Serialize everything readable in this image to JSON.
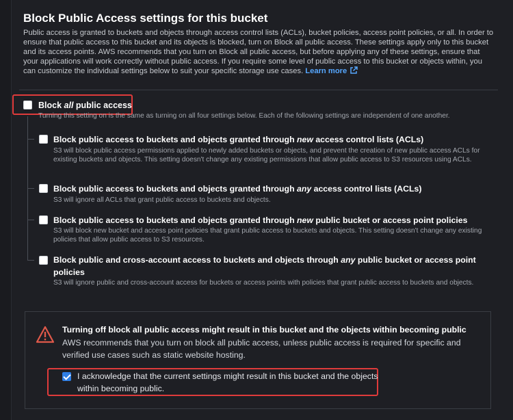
{
  "section": {
    "title": "Block Public Access settings for this bucket",
    "description": "Public access is granted to buckets and objects through access control lists (ACLs), bucket policies, access point policies, or all. In order to ensure that public access to this bucket and its objects is blocked, turn on Block all public access. These settings apply only to this bucket and its access points. AWS recommends that you turn on Block all public access, but before applying any of these settings, ensure that your applications will work correctly without public access. If you require some level of public access to this bucket or objects within, you can customize the individual settings below to suit your specific storage use cases.",
    "learn_more": "Learn more"
  },
  "block_all": {
    "label_pre": "Block ",
    "label_em": "all",
    "label_post": " public access",
    "checked": false,
    "description": "Turning this setting on is the same as turning on all four settings below. Each of the following settings are independent of one another."
  },
  "options": [
    {
      "label_pre": "Block public access to buckets and objects granted through ",
      "label_em": "new",
      "label_post": " access control lists (ACLs)",
      "description": "S3 will block public access permissions applied to newly added buckets or objects, and prevent the creation of new public access ACLs for existing buckets and objects. This setting doesn't change any existing permissions that allow public access to S3 resources using ACLs.",
      "checked": false
    },
    {
      "label_pre": "Block public access to buckets and objects granted through ",
      "label_em": "any",
      "label_post": " access control lists (ACLs)",
      "description": "S3 will ignore all ACLs that grant public access to buckets and objects.",
      "checked": false
    },
    {
      "label_pre": "Block public access to buckets and objects granted through ",
      "label_em": "new",
      "label_post": " public bucket or access point policies",
      "description": "S3 will block new bucket and access point policies that grant public access to buckets and objects. This setting doesn't change any existing policies that allow public access to S3 resources.",
      "checked": false
    },
    {
      "label_pre": "Block public and cross-account access to buckets and objects through ",
      "label_em": "any",
      "label_post": " public bucket or access point policies",
      "description": "S3 will ignore public and cross-account access for buckets or access points with policies that grant public access to buckets and objects.",
      "checked": false
    }
  ],
  "warning": {
    "title": "Turning off block all public access might result in this bucket and the objects within becoming public",
    "body": "AWS recommends that you turn on block all public access, unless public access is required for specific and verified use cases such as static website hosting.",
    "ack_label": "I acknowledge that the current settings might result in this bucket and the objects within becoming public.",
    "ack_checked": true
  },
  "colors": {
    "highlight": "#e03b3b",
    "link": "#56a7ff",
    "checkbox_checked": "#2f7fe5",
    "warning_icon": "#e0594a"
  },
  "icons": {
    "external_link": "external-link-icon",
    "warning": "warning-triangle-icon",
    "checkmark": "checkmark-icon"
  }
}
